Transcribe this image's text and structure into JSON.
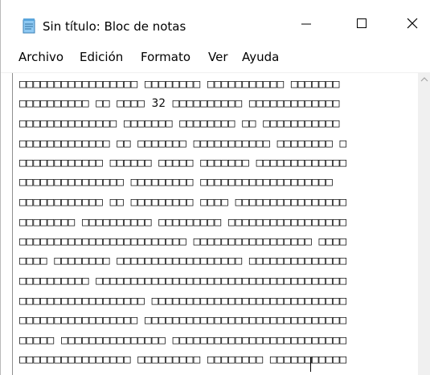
{
  "window": {
    "title": "Sin título: Bloc de notas",
    "icon": "notepad-icon",
    "buttons": {
      "minimize": "—",
      "maximize": "☐",
      "close": "✕"
    }
  },
  "menu": {
    "items": [
      "Archivo",
      "Edición",
      "Formato",
      "Ver",
      "Ayuda"
    ]
  },
  "editor": {
    "lines": [
      "□□□□□□□□□□□□□□□□□ □□□□□□□□ □□□□□□□□□□□ □□□□□□□",
      "□□□□□□□□□□ □□ □□□□ 32 □□□□□□□□□□ □□□□□□□□□□□□□",
      "□□□□□□□□□□□□□□ □□□□□□□ □□□□□□□□ □□ □□□□□□□□□□□",
      "□□□□□□□□□□□□□ □□ □□□□□□□ □□□□□□□□□□□ □□□□□□□□ □",
      "□□□□□□□□□□□□ □□□□□□ □□□□□ □□□□□□□ □□□□□□□□□□□□□",
      "□□□□□□□□□□□□□□□ □□□□□□□□□  □□□□□□□□□□□□□□□□□□□",
      "□□□□□□□□□□□□ □□ □□□□□□□□□ □□□□ □□□□□□□□□□□□□□□□",
      "□□□□□□□□ □□□□□□□□□□ □□□□□□□□□ □□□□□□□□□□□□□□□□□",
      "□□□□□□□□□□□□□□□□□□□□□□□□ □□□□□□□□□□□□□□□□□ □□□□",
      "□□□□ □□□□□□□□ □□□□□□□□□□□□□□□□□□ □□□□□□□□□□□□□□",
      "□□□□□□□□□□ □□□□□□□□□□□□□□□□□□□□□□□□□□□□□□□□□□□□",
      "□□□□□□□□□□□□□□□□□□ □□□□□□□□□□□□□□□□□□□□□□□□□□□□",
      "□□□□□□□□□□□□□□□□□ □□□□□□□□□□□□□□□□□□□□□□□□□□□□□",
      "□□□□□ □□□□□□□□□□□□□□□ □□□□□□□□□□□□□□□□□□□□□□□□□",
      "□□□□□□□□□□□□□□□□ □□□□□□□□□ □□□□□□□□ □□□□□□□□□□□"
    ]
  },
  "colors": {
    "background": "#ffffff",
    "text": "#111111",
    "scrollbar": "#f0f0f0"
  }
}
